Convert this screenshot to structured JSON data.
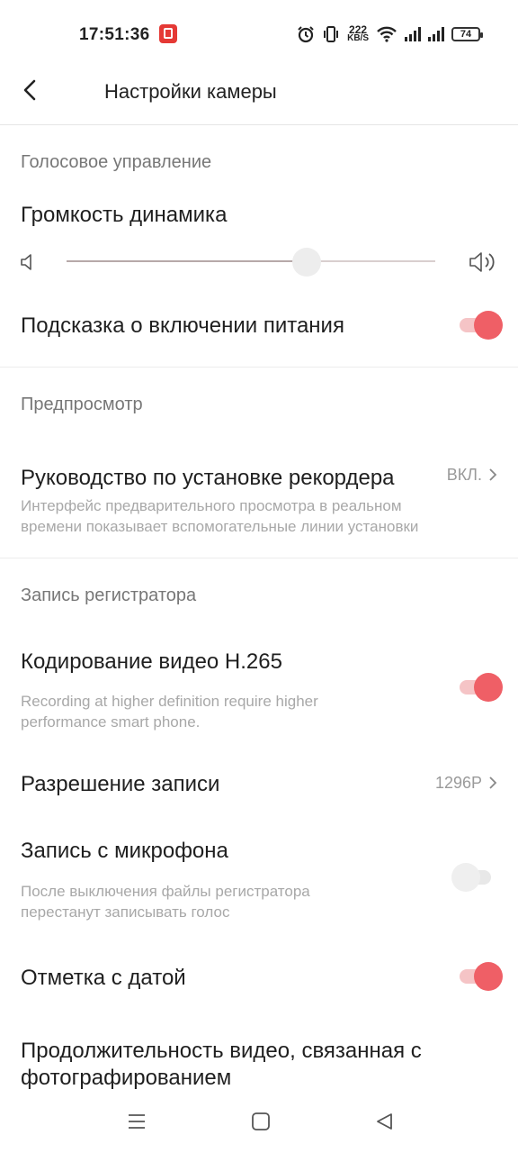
{
  "status": {
    "time": "17:51:36",
    "speed_value": "222",
    "speed_unit": "KB/S",
    "battery": "74"
  },
  "header": {
    "title": "Настройки камеры"
  },
  "voice": {
    "section": "Голосовое управление",
    "volume_label": "Громкость динамика",
    "volume_level_percent": 65,
    "power_hint_label": "Подсказка о включении питания",
    "power_hint_on": true
  },
  "preview": {
    "section": "Предпросмотр",
    "guide_label": "Руководство по установке рекордера",
    "guide_value": "ВКЛ.",
    "guide_desc_1": "Интерфейс предварительного просмотра в реальном",
    "guide_desc_2": "времени показывает вспомогательные линии установки"
  },
  "recording": {
    "section": "Запись регистратора",
    "h265_label": "Кодирование видео H.265",
    "h265_desc_1": "Recording at higher definition require higher",
    "h265_desc_2": "performance smart phone.",
    "h265_on": true,
    "resolution_label": "Разрешение записи",
    "resolution_value": "1296P",
    "mic_label": "Запись с микрофона",
    "mic_desc_1": "После выключения файлы регистратора",
    "mic_desc_2": "перестанут записывать голос",
    "mic_on": false,
    "date_label": "Отметка с датой",
    "date_on": true,
    "duration_label_1": "Продолжительность видео, связанная с",
    "duration_label_2": "фотографированием"
  },
  "colors": {
    "accent": "#ef5f66",
    "accent_track": "#f5c4c6"
  }
}
